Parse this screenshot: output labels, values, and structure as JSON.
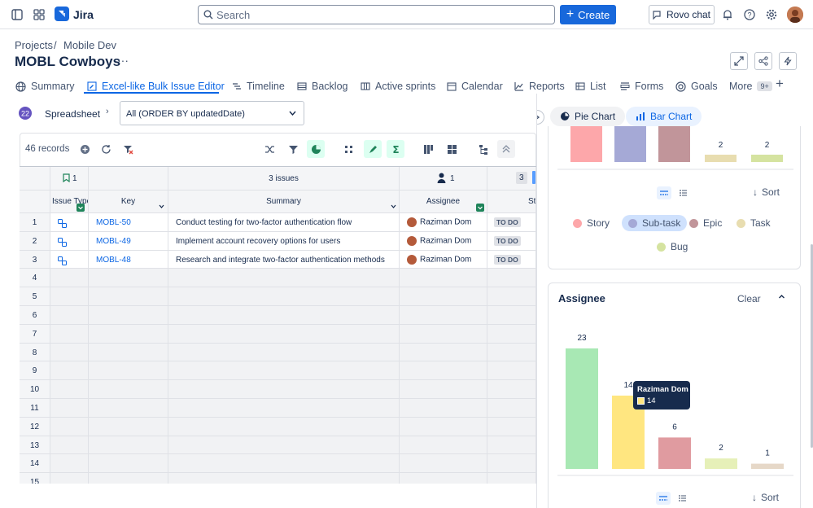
{
  "topbar": {
    "app_name": "Jira",
    "search_placeholder": "Search",
    "create_label": "Create",
    "rovo_label": "Rovo chat"
  },
  "breadcrumb": {
    "projects": "Projects",
    "separator": "/",
    "space": "Mobile Dev"
  },
  "page_title": "MOBL Cowboys",
  "tabs": [
    {
      "label": "Summary"
    },
    {
      "label": "Excel-like Bulk Issue Editor"
    },
    {
      "label": "Timeline"
    },
    {
      "label": "Backlog"
    },
    {
      "label": "Active sprints"
    },
    {
      "label": "Calendar"
    },
    {
      "label": "Reports"
    },
    {
      "label": "List"
    },
    {
      "label": "Forms"
    },
    {
      "label": "Goals"
    },
    {
      "label": "More"
    }
  ],
  "more_badge": "9+",
  "toolbar": {
    "view_label": "Spreadsheet",
    "filter_value": "All (ORDER BY updatedDate)",
    "records": "46 records"
  },
  "grid": {
    "group_row": {
      "bookmark_count": "1",
      "issues": "3 issues",
      "assignee_count": "1",
      "status_count": "3"
    },
    "columns": [
      "Issue Type",
      "Key",
      "Summary",
      "Assignee",
      "St"
    ],
    "rows": [
      {
        "num": "1",
        "key": "MOBL-50",
        "summary": "Conduct testing for two-factor authentication flow",
        "assignee": "Raziman Dom",
        "status": "TO DO"
      },
      {
        "num": "2",
        "key": "MOBL-49",
        "summary": "Implement account recovery options for users",
        "assignee": "Raziman Dom",
        "status": "TO DO"
      },
      {
        "num": "3",
        "key": "MOBL-48",
        "summary": "Research and integrate two-factor authentication methods",
        "assignee": "Raziman Dom",
        "status": "TO DO"
      }
    ],
    "empty_rows": [
      "4",
      "5",
      "6",
      "7",
      "8",
      "9",
      "10",
      "11",
      "12",
      "13",
      "14",
      "15"
    ]
  },
  "right_panel": {
    "pie_label": "Pie Chart",
    "bar_label": "Bar Chart",
    "sort_label": "Sort",
    "type_card": {
      "legend": [
        "Story",
        "Sub-task",
        "Epic",
        "Task",
        "Bug"
      ]
    },
    "assignee_card": {
      "title": "Assignee",
      "clear_label": "Clear",
      "tooltip_name": "Raziman Dom",
      "tooltip_value": "14"
    },
    "colors": {
      "story": "#fda7aa",
      "subtask": "#a5a9d6",
      "epic": "#c1959a",
      "task": "#e8ddb0",
      "bug": "#d5e3a0",
      "green_bar": "#a8e8b4",
      "yellow_bar": "#ffe680",
      "pink_bar": "#e09ba0",
      "lime_bar": "#e6f0b8",
      "tan_bar": "#e6d8c8"
    }
  },
  "chart_data": [
    {
      "type": "bar",
      "categories": [
        "Story",
        "Sub-task",
        "Epic",
        "Task",
        "Bug"
      ],
      "values": [
        null,
        null,
        null,
        2,
        2
      ],
      "title": "",
      "xlabel": "",
      "ylabel": ""
    },
    {
      "type": "bar",
      "title": "Assignee",
      "categories": [
        "",
        "Raziman Dom",
        "",
        "",
        ""
      ],
      "values": [
        23,
        14,
        6,
        2,
        1
      ],
      "ylim": [
        0,
        23
      ],
      "xlabel": "",
      "ylabel": ""
    }
  ]
}
